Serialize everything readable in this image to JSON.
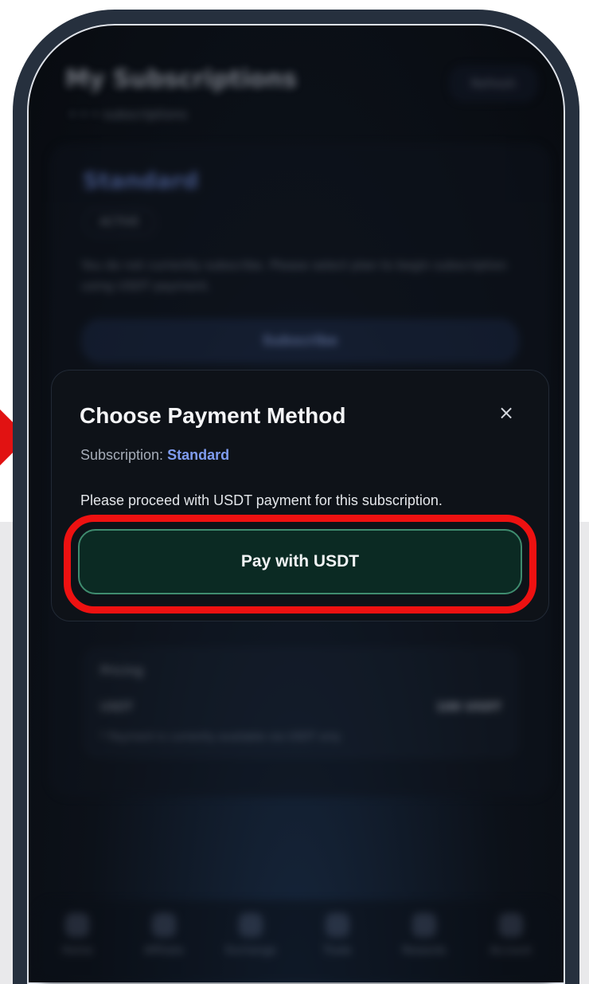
{
  "background": {
    "title": "My Subscriptions",
    "subtitle": "• • • subscriptions",
    "header_button": "Refresh",
    "plan_name": "Standard",
    "plan_badge": "ACTIVE",
    "plan_description": "You do not currently subscribe. Please select plan to begin subscription using USDT payment.",
    "subscribe_button": "Subscribe",
    "pricing": {
      "title": "Pricing",
      "currency": "USDT",
      "amount": "100 USDT",
      "note": "* Payment is currently available via USDT only"
    },
    "nav": [
      "Home",
      "Affiliate",
      "Exchange",
      "Trade",
      "Rewards",
      "Account"
    ]
  },
  "modal": {
    "title": "Choose Payment Method",
    "close_glyph": "×",
    "subscription_label": "Subscription:",
    "subscription_plan": "Standard",
    "message": "Please proceed with USDT payment for this subscription.",
    "pay_button": "Pay with USDT"
  },
  "colors": {
    "highlight": "#ee1111",
    "plan_accent": "#7f9cf0",
    "pay_button_bg": "#0b2a23",
    "pay_button_border": "#3f8c6f"
  }
}
